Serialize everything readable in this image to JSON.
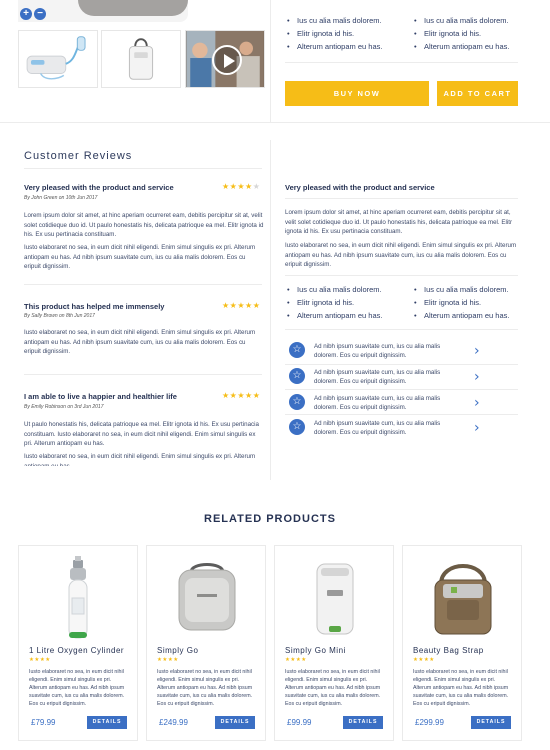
{
  "gallery": {
    "zoom_in": "+",
    "zoom_out": "−"
  },
  "top_bullets": {
    "col1": [
      "Ius cu alia malis dolorem.",
      "Elitr ignota id his.",
      "Alterum antiopam eu has."
    ],
    "col2": [
      "Ius cu alia malis dolorem.",
      "Elitr ignota id his.",
      "Alterum antiopam eu has."
    ]
  },
  "buttons": {
    "buy_now": "BUY NOW",
    "add_to_cart": "ADD TO CART"
  },
  "reviews": {
    "title": "Customer Reviews",
    "items": [
      {
        "title": "Very pleased with the product and service",
        "byline": "By John Green on 10th Jun 2017",
        "rating": 4,
        "p1": "Lorem ipsum dolor sit amet, at hinc aperiam ocurreret eam, debitis percipitur sit at, velit solet cotidieque duo id. Ut paulo honestatis his, delicata patrioque ea mel. Elitr ignota id his. Ex usu pertinacia constituam.",
        "p2": "Iusto elaboraret no sea, in eum dicit nihil eligendi. Enim simul singulis ex pri. Alterum antiopam eu has. Ad nibh ipsum suavitate cum, ius cu alia malis dolorem. Eos cu eripuit dignissim."
      },
      {
        "title": "This product has helped me immensely",
        "byline": "By Sally Brown on 8th Jun 2017",
        "rating": 5,
        "p1": "Iusto elaboraret no sea, in eum dicit nihil eligendi. Enim simul singulis ex pri. Alterum antiopam eu has. Ad nibh ipsum suavitate cum, ius cu alia malis dolorem. Eos cu eripuit dignissim.",
        "p2": ""
      },
      {
        "title": "I am able to live a happier and healthier life",
        "byline": "By Emily Robinson on 3rd Jun 2017",
        "rating": 5,
        "p1": "Ut paulo honestatis his, delicata patrioque ea mel. Elitr ignota id his. Ex usu pertinacia constituam. Iusto elaboraret no sea, in eum dicit nihil eligendi. Enim simul singulis ex pri. Alterum antiopam eu has.",
        "p2": "Iusto elaboraret no sea, in eum dicit nihil eligendi. Enim simul singulis ex pri. Alterum antiopam eu has."
      }
    ]
  },
  "right_panel": {
    "title": "Very pleased with the product and service",
    "p1": "Lorem ipsum dolor sit amet, at hinc aperiam ocurreret eam, debitis percipitur sit at, velit solet cotidieque duo id. Ut paulo honestatis his, delicata patrioque ea mel. Elitr ignota id his. Ex usu pertinacia constituam.",
    "p2": "Iusto elaboraret no sea, in eum dicit nihil eligendi. Enim simul singulis ex pri. Alterum antiopam eu has. Ad nibh ipsum suavitate cum, ius cu alia malis dolorem. Eos cu eripuit dignissim.",
    "bullets_col1": [
      "Ius cu alia malis dolorem.",
      "Elitr ignota id his.",
      "Alterum antiopam eu has."
    ],
    "bullets_col2": [
      "Ius cu alia malis dolorem.",
      "Elitr ignota id his.",
      "Alterum antiopam eu has."
    ],
    "features": [
      "Ad nibh ipsum suavitate cum, ius cu alia malis dolorem. Eos cu eripuit dignissim.",
      "Ad nibh ipsum suavitate cum, ius cu alia malis dolorem. Eos cu eripuit dignissim.",
      "Ad nibh ipsum suavitate cum, ius cu alia malis dolorem. Eos cu eripuit dignissim.",
      "Ad nibh ipsum suavitate cum, ius cu alia malis dolorem. Eos cu eripuit dignissim."
    ]
  },
  "related": {
    "title": "RELATED PRODUCTS",
    "details_label": "DETAILS",
    "products": [
      {
        "name": "1 Litre Oxygen Cylinder",
        "rating": "★★★★",
        "price": "£79.99",
        "desc": "Iusto elaboraret no sea, in eum dicit nihil eligendi. Enim simul singulis ex pri. Alterum antiopam eu has. Ad nibh ipsum suavitate cum, ius cu alia malis dolorem. Eos cu eripuit dignissim."
      },
      {
        "name": "Simply Go",
        "rating": "★★★★",
        "price": "£249.99",
        "desc": "Iusto elaboraret no sea, in eum dicit nihil eligendi. Enim simul singulis ex pri. Alterum antiopam eu has. Ad nibh ipsum suavitate cum, ius cu alia malis dolorem. Eos cu eripuit dignissim."
      },
      {
        "name": "Simply Go Mini",
        "rating": "★★★★",
        "price": "£99.99",
        "desc": "Iusto elaboraret no sea, in eum dicit nihil eligendi. Enim simul singulis ex pri. Alterum antiopam eu has. Ad nibh ipsum suavitate cum, ius cu alia malis dolorem. Eos cu eripuit dignissim."
      },
      {
        "name": "Beauty Bag Strap",
        "rating": "★★★★",
        "price": "£299.99",
        "desc": "Iusto elaboraret no sea, in eum dicit nihil eligendi. Enim simul singulis ex pri. Alterum antiopam eu has. Ad nibh ipsum suavitate cum, ius cu alia malis dolorem. Eos cu eripuit dignissim."
      }
    ]
  },
  "colors": {
    "accent_blue": "#3b6fc4",
    "accent_yellow": "#f6bd17",
    "heading_navy": "#263253"
  }
}
